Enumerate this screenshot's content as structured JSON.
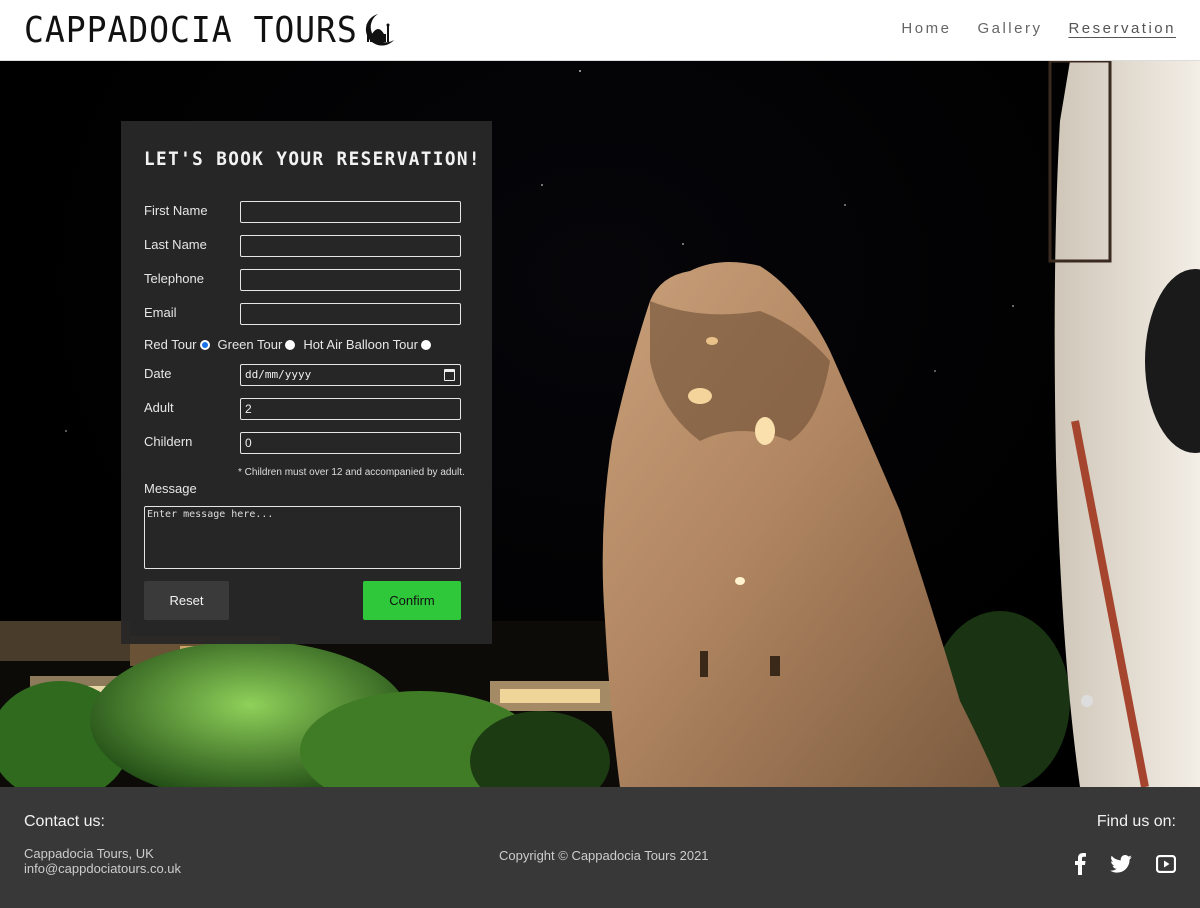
{
  "header": {
    "brand": "CAPPADOCIA TOURS",
    "logo_icon": "mosque-crescent-icon",
    "nav": [
      {
        "label": "Home",
        "active": false
      },
      {
        "label": "Gallery",
        "active": false
      },
      {
        "label": "Reservation",
        "active": true
      }
    ]
  },
  "form": {
    "title": "LET'S BOOK YOUR RESERVATION!",
    "first_name_label": "First Name",
    "first_name_value": "",
    "last_name_label": "Last Name",
    "last_name_value": "",
    "telephone_label": "Telephone",
    "telephone_value": "",
    "email_label": "Email",
    "email_value": "",
    "tour_options": [
      {
        "label": "Red Tour",
        "checked": true
      },
      {
        "label": "Green Tour",
        "checked": false
      },
      {
        "label": "Hot Air Balloon Tour",
        "checked": false
      }
    ],
    "date_label": "Date",
    "date_placeholder": "dd/mm/yyyy",
    "adult_label": "Adult",
    "adult_value": "2",
    "children_label": "Childern",
    "children_value": "0",
    "children_note": "* Children must over 12 and accompanied by adult.",
    "message_label": "Message",
    "message_placeholder": "Enter message here...",
    "reset_label": "Reset",
    "confirm_label": "Confirm",
    "confirm_color": "#2fc83a"
  },
  "footer": {
    "contact_title": "Contact us:",
    "address_line": "Cappadocia Tours, UK",
    "email": "info@cappdociatours.co.uk",
    "copyright": "Copyright © Cappadocia Tours 2021",
    "find_title": "Find us on:",
    "social_icons": [
      "facebook-icon",
      "twitter-icon",
      "youtube-icon"
    ]
  }
}
